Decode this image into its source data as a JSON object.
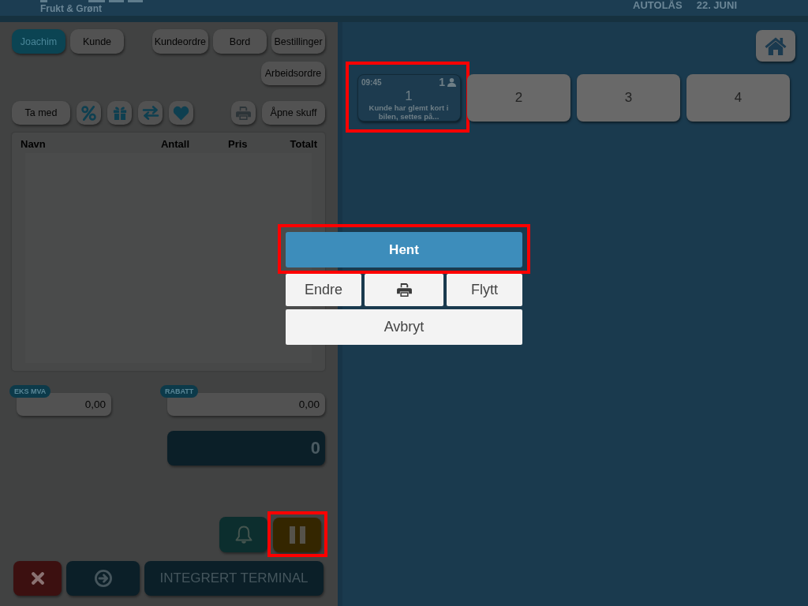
{
  "header": {
    "subtitle": "Frukt & Grønt",
    "autolock": "AUTOLÅS",
    "date": "22. JUNI"
  },
  "left": {
    "mode_buttons": [
      {
        "label": "Joachim",
        "selected": true
      },
      {
        "label": "Kunde",
        "selected": false
      }
    ],
    "nav_buttons": [
      "Kundeordre",
      "Bord",
      "Bestillinger",
      "Arbeidsordre"
    ],
    "take_away": "Ta med",
    "open_drawer": "Åpne skuff",
    "order_table": {
      "columns": [
        "Navn",
        "Antall",
        "Pris",
        "Totalt"
      ]
    },
    "ex_vat": {
      "label": "EKS MVA",
      "value": "0,00"
    },
    "discount": {
      "label": "RABATT",
      "value": "0,00"
    },
    "total": "0",
    "pause": {
      "highlighted": true
    },
    "terminal": "INTEGRERT TERMINAL"
  },
  "tables": [
    {
      "number": "1",
      "occupied": true,
      "time": "09:45",
      "guests": "1",
      "note": "Kunde har glemt kort i bilen, settes på...",
      "highlighted": true
    },
    {
      "number": "2",
      "occupied": false,
      "highlighted": false
    },
    {
      "number": "3",
      "occupied": false,
      "highlighted": false
    },
    {
      "number": "4",
      "occupied": false,
      "highlighted": false
    }
  ],
  "dialog": {
    "primary": {
      "label": "Hent",
      "highlighted": true
    },
    "actions": [
      {
        "kind": "text",
        "label": "Endre"
      },
      {
        "kind": "print"
      },
      {
        "kind": "text",
        "label": "Flytt"
      }
    ],
    "cancel": "Avbryt"
  }
}
